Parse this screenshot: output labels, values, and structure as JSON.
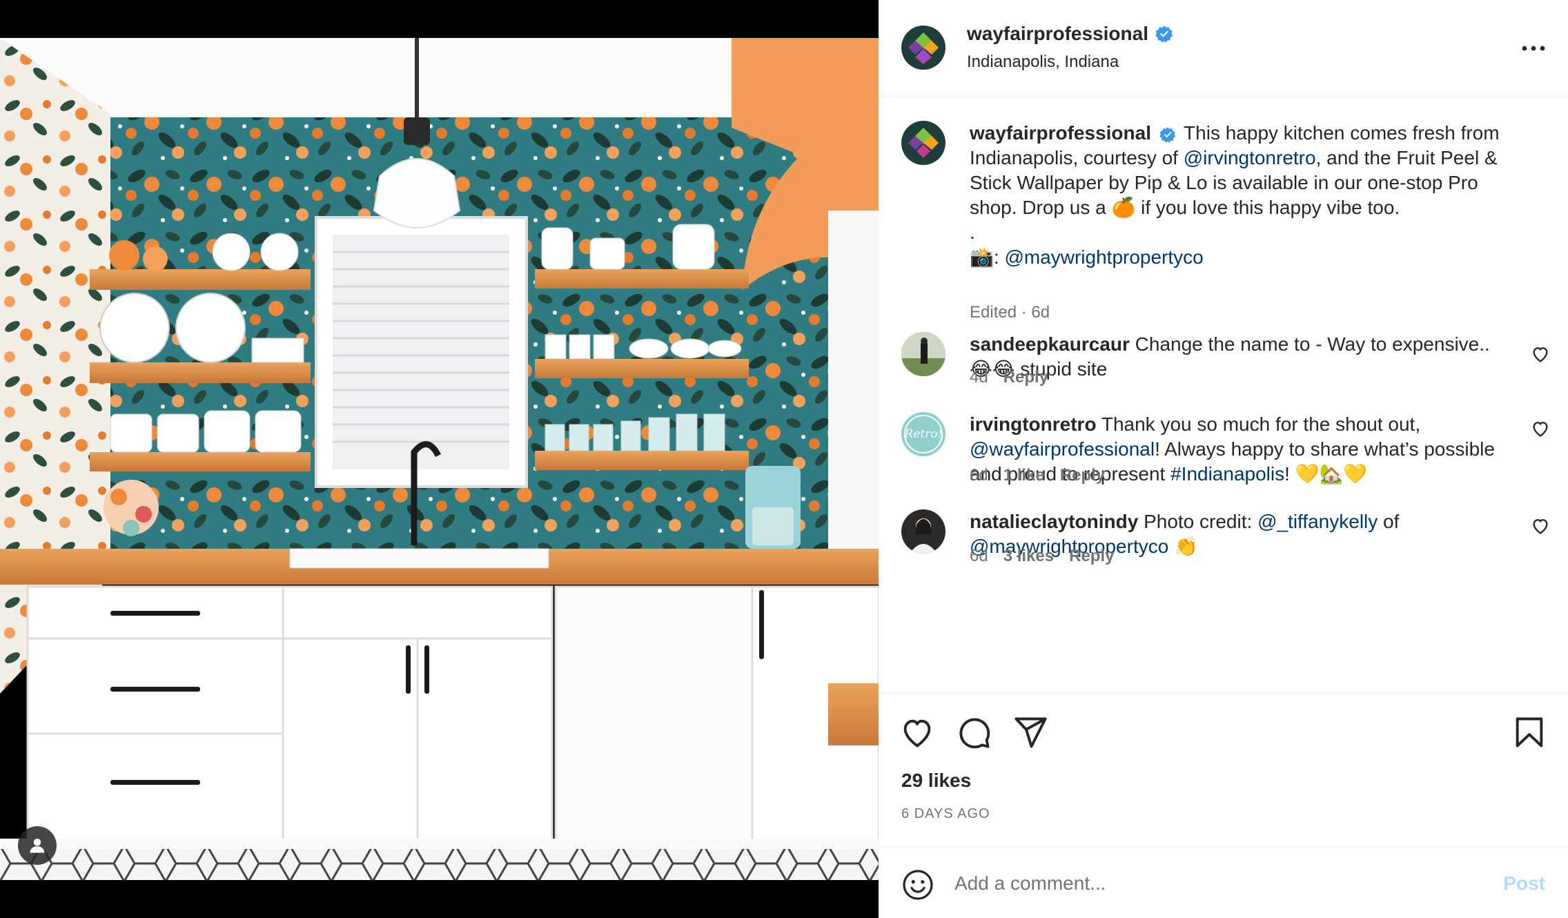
{
  "header": {
    "username": "wayfairprofessional",
    "location": "Indianapolis, Indiana",
    "avatar_icon": "wayfair-logo-icon",
    "verified_icon": "verified-badge-icon",
    "more_icon": "more-options-icon"
  },
  "caption": {
    "username": "wayfairprofessional",
    "text_1": "This happy kitchen comes fresh from Indianapolis, courtesy of ",
    "mention_1": "@irvingtonretro",
    "text_2": ", and the Fruit Peel & Stick Wallpaper by Pip & Lo is available in our one-stop Pro shop. Drop us a ",
    "emoji_1": "🍊",
    "text_3": " if you love this happy vibe too.",
    "dot_line": ".",
    "camera_emoji": "📸",
    "credit_sep": ": ",
    "mention_2": "@maywrightpropertyco",
    "meta": "Edited · 6d"
  },
  "comments": [
    {
      "username": "sandeepkaurcaur",
      "text_1": "Change the name to - Way to expensive..",
      "emoji": "😂😂",
      "text_2": " stupid site",
      "age": "4d",
      "likes": "",
      "reply": "Reply"
    },
    {
      "username": "irvingtonretro",
      "text_1": "Thank you so much for the shout out, ",
      "mention_1": "@wayfairprofessional",
      "text_2": "! Always happy to share what’s possible and proud to represent ",
      "hashtag": "#Indianapolis",
      "text_3": "! ",
      "emoji": "💛🏡💛",
      "age": "6d",
      "likes": "1 like",
      "reply": "Reply",
      "avatar_text": "Retro!"
    },
    {
      "username": "natalieclaytonindy",
      "text_1": "Photo credit: ",
      "mention_1": "@_tiffanykelly",
      "text_2": " of ",
      "mention_2": "@maywrightpropertyco",
      "emoji": " 👏",
      "age": "6d",
      "likes": "3 likes",
      "reply": "Reply"
    }
  ],
  "actions": {
    "like_icon": "heart-icon",
    "comment_icon": "comment-icon",
    "share_icon": "share-icon",
    "save_icon": "bookmark-icon",
    "likes_text": "29 likes",
    "date_text": "6 DAYS AGO"
  },
  "add_comment": {
    "placeholder": "Add a comment...",
    "post_label": "Post",
    "emoji_icon": "smiley-icon"
  },
  "media": {
    "alt": "Kitchen with orange fruit wallpaper, open wooden shelves, white cabinets and hexagon tile floor",
    "tag_icon": "user-tag-icon"
  }
}
